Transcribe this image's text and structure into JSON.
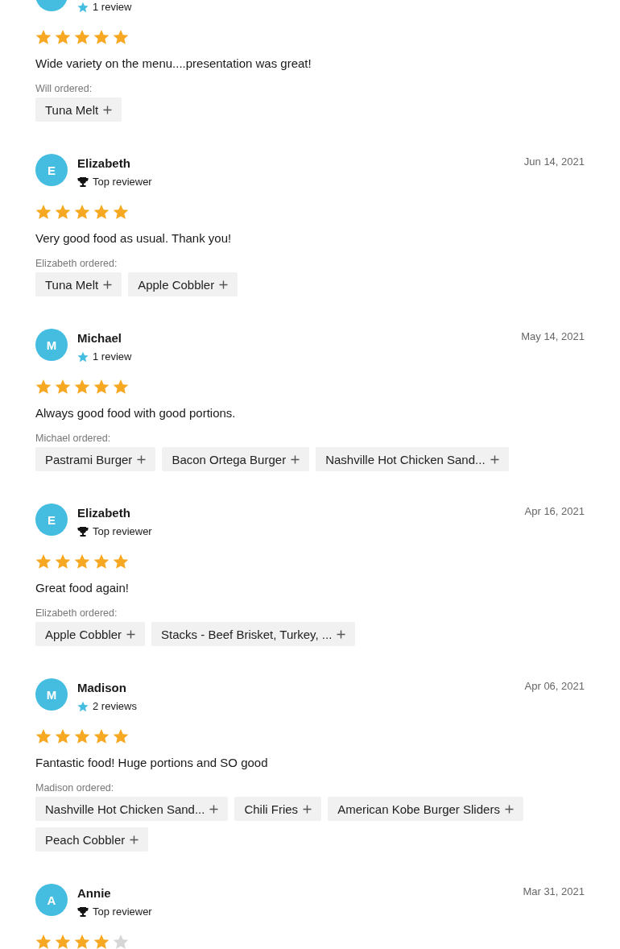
{
  "reviews": [
    {
      "badge": {
        "kind": "count",
        "label": "1 review"
      },
      "stars": 5,
      "text": "Wide variety on the menu....presentation was great!",
      "ordered_label": "Will ordered:",
      "items": [
        "Tuna Melt"
      ]
    },
    {
      "initial": "E",
      "name": "Elizabeth",
      "date": "Jun 14, 2021",
      "badge": {
        "kind": "top",
        "label": "Top reviewer"
      },
      "stars": 5,
      "text": "Very good food as usual. Thank you!",
      "ordered_label": "Elizabeth ordered:",
      "items": [
        "Tuna Melt",
        "Apple Cobbler"
      ]
    },
    {
      "initial": "M",
      "name": "Michael",
      "date": "May 14, 2021",
      "badge": {
        "kind": "count",
        "label": "1 review"
      },
      "stars": 5,
      "text": "Always good food with good portions.",
      "ordered_label": "Michael ordered:",
      "items": [
        "Pastrami Burger",
        "Bacon Ortega Burger",
        "Nashville Hot Chicken Sand..."
      ]
    },
    {
      "initial": "E",
      "name": "Elizabeth",
      "date": "Apr 16, 2021",
      "badge": {
        "kind": "top",
        "label": "Top reviewer"
      },
      "stars": 5,
      "text": "Great food again!",
      "ordered_label": "Elizabeth ordered:",
      "items": [
        "Apple Cobbler",
        "Stacks - Beef Brisket, Turkey, ..."
      ]
    },
    {
      "initial": "M",
      "name": "Madison",
      "date": "Apr 06, 2021",
      "badge": {
        "kind": "count",
        "label": "2 reviews"
      },
      "stars": 5,
      "text": "Fantastic food! Huge portions and SO good",
      "ordered_label": "Madison ordered:",
      "items": [
        "Nashville Hot Chicken Sand...",
        "Chili Fries",
        "American Kobe Burger Sliders",
        "Peach Cobbler"
      ]
    },
    {
      "initial": "A",
      "name": "Annie",
      "date": "Mar 31, 2021",
      "badge": {
        "kind": "top",
        "label": "Top reviewer"
      },
      "stars": 4
    }
  ]
}
